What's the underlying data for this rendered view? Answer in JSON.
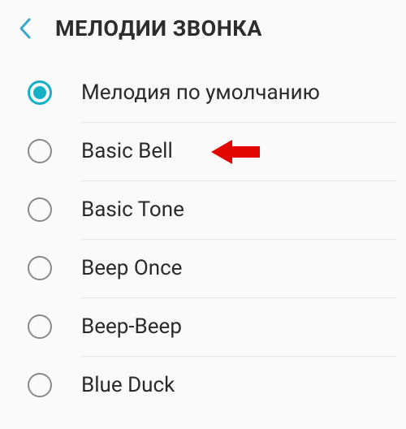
{
  "header": {
    "title": "МЕЛОДИИ ЗВОНКА"
  },
  "accent_color": "#17b1c7",
  "ringtones": [
    {
      "label": "Мелодия по умолчанию",
      "selected": true
    },
    {
      "label": "Basic Bell",
      "selected": false
    },
    {
      "label": "Basic Tone",
      "selected": false
    },
    {
      "label": "Beep Once",
      "selected": false
    },
    {
      "label": "Beep-Beep",
      "selected": false
    },
    {
      "label": "Blue Duck",
      "selected": false
    }
  ],
  "annotation": {
    "arrow_color": "#e10600",
    "points_to_index": 1
  }
}
